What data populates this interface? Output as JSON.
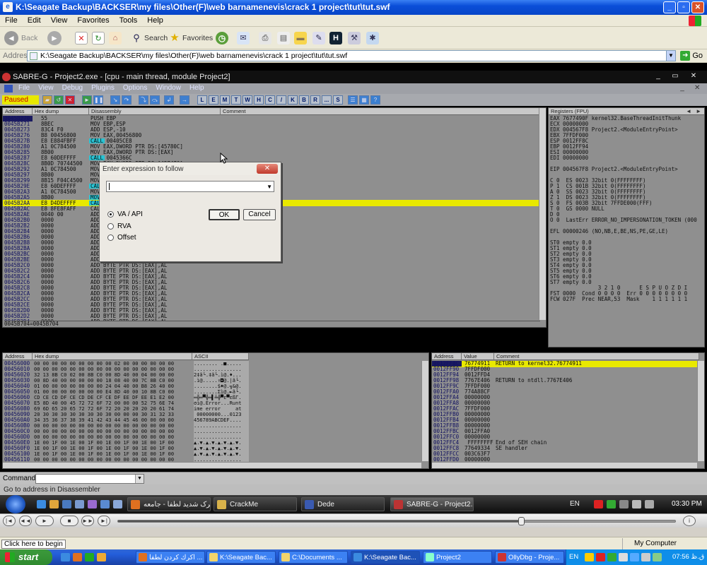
{
  "ie": {
    "title": "K:\\Seagate Backup\\BACKSER\\my files\\Other(F)\\web barnamenevis\\crack 1 project\\tut\\tut.swf",
    "menu": [
      "File",
      "Edit",
      "View",
      "Favorites",
      "Tools",
      "Help"
    ],
    "toolbar": {
      "back": "Back",
      "search": "Search",
      "favorites": "Favorites"
    },
    "address_label": "Address",
    "address_value": "K:\\Seagate Backup\\BACKSER\\my files\\Other(F)\\web barnamenevis\\crack 1 project\\tut\\tut.swf",
    "go": "Go",
    "status": "Click here to begin",
    "zone": "My Computer"
  },
  "olly": {
    "title": "SABRE-G - Project2.exe - [cpu - main thread, module Project2]",
    "menu": [
      "File",
      "View",
      "Debug",
      "Plugins",
      "Options",
      "Window",
      "Help"
    ],
    "state": "Paused",
    "toolbar_letters": [
      "L",
      "E",
      "M",
      "T",
      "W",
      "H",
      "C",
      "/",
      "K",
      "B",
      "R",
      "...",
      "S"
    ],
    "cpu": {
      "headers": [
        "Address",
        "Hex dump",
        "Disassembly",
        "Comment"
      ],
      "addresses": "0045B270\n0045B271\n0045B273\n0045B276\n0045B27B\n0045B280\n0045B285\n0045B287\n0045B28C\n0045B292\n0045B297\n0045B299\n0045B29E\n0045B2A3\n0045B2A5\n0045B2AA\n0045B2AC\n0045B2AE\n0045B2B0\n0045B2B2\n0045B2B4\n0045B2B6\n0045B2B8\n0045B2BA\n0045B2BC\n0045B2BE\n0045B2C0\n0045B2C2\n0045B2C4\n0045B2C6\n0045B2C8\n0045B2CA\n0045B2CC\n0045B2CE\n0045B2D0\n0045B2D2\n0045B2D4\n0045B2D6\n0045B2D8",
      "hex": "55\n8BEC\n83C4 F0\nB8 00456800\nE8 E884FBFF\nA1 0C784500\n8B00\nE8 60DEFFFF\n8B0D 70744500\nA1 0C784500\n8B00\n8B15 F04C4500\nE8 60DEFFFF\nA1 0C784500\n8B00\nE8 D4DEFFFF\nE8 8FE8FAFF\n0040 00\n0000\n0000\n0000\n0000\n0000\n0000\n0000\n0000\n0000\n0000\n0000\n0000\n0000\n0000\n0000\n0000\n0000\n0000\n0000\n0000\n0000",
      "disasm": "PUSH EBP\nMOV EBP,ESP\nADD ESP,-10\nMOV EAX,00456800\nCALL 00405CE8\nMOV EAX,DWORD PTR DS:[45780C]\nMOV EAX,DWORD PTR DS:[EAX]\nCALL 0045366C\nMOV ECX,DWORD PTR DS:[457470]\nMOV EAX,DWORD PTR DS:[45780C]\nMOV EAX,DWORD PTR DS:[EAX]\nMOV EDX,DWORD PTR DS:[454CF0]\nCALL 00453684\nMOV EAX,DWORD PTR DS:[45780C]\nMOV EAX,DWORD PTR DS:[EAX]\nCALL 00453704\nCALL 00403144\nADD BYTE PTR DS:[EAX],AL\nADD BYTE PTR DS:[EAX],AL\nADD BYTE PTR DS:[EAX],AL\nADD BYTE PTR DS:[EAX],AL\nADD BYTE PTR DS:[EAX],AL\nADD BYTE PTR DS:[EAX],AL\nADD BYTE PTR DS:[EAX],AL\nADD BYTE PTR DS:[EAX],AL\nADD BYTE PTR DS:[EAX],AL\nADD BYTE PTR DS:[EAX],AL\nADD BYTE PTR DS:[EAX],AL\nADD BYTE PTR DS:[EAX],AL\nADD BYTE PTR DS:[EAX],AL\nADD BYTE PTR DS:[EAX],AL\nADD BYTE PTR DS:[EAX],AL\nADD BYTE PTR DS:[EAX],AL\nADD BYTE PTR DS:[EAX],AL\nADD BYTE PTR DS:[EAX],AL\nADD BYTE PTR DS:[EAX],AL\nADD BYTE PTR DS:[EAX],AL\nADD BYTE PTR DS:[EAX],AL\nADD BYTE PTR DS:[EAX],AL",
      "info": "0045B704=0045B704"
    },
    "registers": {
      "header": "Registers (FPU)",
      "text": "EAX 7677490F kernel32.BaseThreadInitThunk\nECX 00000000\nEDX 004567F8 Project2.<ModuleEntryPoint>\nEBX 7FFDF000\nESP 0012FF8C\nEBP 0012FF94\nESI 00000000\nEDI 00000000\n\nEIP 004567F8 Project2.<ModuleEntryPoint>\n\nC 0  ES 0023 32bit 0(FFFFFFFF)\nP 1  CS 001B 32bit 0(FFFFFFFF)\nA 0  SS 0023 32bit 0(FFFFFFFF)\nZ 1  DS 0023 32bit 0(FFFFFFFF)\nS 0  FS 003B 32bit 7FFDE000(FFF)\nT 0  GS 0000 NULL\nD 0\nO 0  LastErr ERROR_NO_IMPERSONATION_TOKEN (000\n\nEFL 00000246 (NO,NB,E,BE,NS,PE,GE,LE)\n\nST0 empty 0.0\nST1 empty 0.0\nST2 empty 0.0\nST3 empty 0.0\nST4 empty 0.0\nST5 empty 0.0\nST6 empty 0.0\nST7 empty 0.0\n               3 2 1 0      E S P U O Z D I\nFST 0000  Cond 0 0 0 0  Err 0 0 0 0 0 0 0 0\nFCW 027F  Prec NEAR,53  Mask    1 1 1 1 1 1"
    },
    "dump": {
      "headers": [
        "Address",
        "Hex dump",
        "ASCII"
      ],
      "addresses": "00456000\n00456010\n00456020\n00456030\n00456040\n00456050\n00456060\n00456070\n00456080\n00456090\n004560A0\n004560B0\n004560C0\n004560D0\n004560E0\n004560F0\n00456100\n00456110",
      "hex": "00 00 00 00 00 00 00 00 00 02 00 00 00 00 00 00\n00 00 00 00 00 00 00 00 00 00 00 00 00 00 00 00\n32 13 8B C0 02 00 8B C0 00 8D 40 00 04 00 00 00\n00 8D 40 00 00 00 00 00 18 08 40 00 7C 8B C0 00\n01 00 00 00 00 00 00 00 24 04 40 00 B8 26 40 00\n01 00 00 00 00 00 00 00 E4 8D 40 00 10 8B C0 00\nCD CE CD DF CE CD DE CF CE DF EE DF EE E1 E2 00\nE5 8D 40 00 45 72 72 6F 72 00 00 00 52 75 6E 74\n69 6D 65 20 65 72 72 6F 72 20 20 20 20 20 61 74\n20 30 30 30 30 30 30 30 30 00 00 00 30 31 32 33\n34 35 36 37 38 39 41 42 43 44 45 46 00 00 00 00\n00 00 00 00 00 00 00 00 00 00 00 00 00 00 00 00\n00 00 00 00 00 00 00 00 00 00 00 00 00 00 00 00\n00 00 00 00 00 00 00 00 00 00 00 00 00 00 00 00\n1E 00 1F 00 1E 00 1F 00 1E 00 1F 00 1E 00 1F 00\n1E 00 1F 00 1E 00 1F 00 1E 00 1F 00 1E 00 1F 00\n1E 00 1F 00 1E 00 1F 00 1E 00 1F 00 1E 00 1F 00\n00 00 00 00 00 00 00 00 00 00 00 00 00 00 00 00",
      "ascii": "........ .■.....\n................\n2‡ã└.‡ã└.ì@.♦...\n.ì@.....↑◘@.|ã└.\n........$♦@.╗&@.\n........Σì@.►ã└.\n═╬═▀╬═▌╧╬▀ε▀εßΓ.\nσì@.Error...Runt\nime error     at\n 00000000...0123\n456789ABCDEF....\n................\n................\n................\n▲.▼.▲.▼.▲.▼.▲.▼.\n▲.▼.▲.▼.▲.▼.▲.▼.\n▲.▼.▲.▼.▲.▼.▲.▼.\n................"
    },
    "stack": {
      "headers": [
        "Address",
        "Value",
        "Comment"
      ],
      "addresses": "0012FF8C\n0012FF90\n0012FF94\n0012FF98\n0012FF9C\n0012FFA0\n0012FFA4\n0012FFA8\n0012FFAC\n0012FFB0\n0012FFB4\n0012FFB8\n0012FFBC\n0012FFC0\n0012FFC4\n0012FFC8\n0012FFCC\n0012FFD0",
      "values": "76774911\n7FFDF000\n0012FFD4\n7767E406\n7FFDF000\n774A88CF\n00000000\n00000000\n7FFDF000\n00000000\n00000000\n00000000\n0012FFA0\n00000000\n FFFFFFFF\n77649334\n003C63F7\n00000000",
      "comments": "RETURN to kernel32.76774911\n\n\nRETURN to ntdll.7767E406\n\n\n\n\n\n\n\n\n\n\nEnd of SEH chain\nSE handler\n\n"
    },
    "dialog": {
      "title": "Enter expression to follow",
      "options": [
        "VA / API",
        "RVA",
        "Offset"
      ],
      "selected": "VA / API",
      "ok": "OK",
      "cancel": "Cancel"
    },
    "command_label": "Command :",
    "status": "Go to address in Disassembler"
  },
  "vista_taskbar": {
    "items": [
      "کرک شدید لطفا - جامعه",
      "CrackMe",
      "Dede",
      "SABRE-G - Project2..."
    ],
    "lang": "EN",
    "clock": "03:30 PM"
  },
  "xp_taskbar": {
    "start": "start",
    "items": [
      "اكرك كردن لطفا ...",
      "K:\\Seagate Bac...",
      "C:\\Documents ...",
      "K:\\Seagate Bac...",
      "Project2",
      "OllyDbg - Proje..."
    ],
    "lang": "EN",
    "clock": "07:56 ق.ظ"
  }
}
